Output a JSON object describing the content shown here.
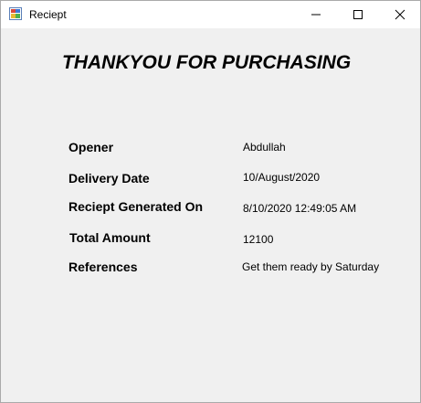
{
  "window": {
    "title": "Reciept",
    "app_icon": "winforms-app-icon",
    "controls": {
      "minimize": "minimize-icon",
      "maximize": "maximize-icon",
      "close": "close-icon"
    }
  },
  "receipt": {
    "heading": "THANKYOU FOR PURCHASING",
    "fields": [
      {
        "label": "Opener",
        "value": "Abdullah"
      },
      {
        "label": "Delivery Date",
        "value": "10/August/2020"
      },
      {
        "label": "Reciept Generated On",
        "value": "8/10/2020 12:49:05 AM"
      },
      {
        "label": "Total Amount",
        "value": "12100"
      },
      {
        "label": "References",
        "value": "Get them ready by Saturday"
      }
    ]
  },
  "colors": {
    "client_background": "#f0f0f0",
    "titlebar_background": "#ffffff",
    "text": "#000000"
  }
}
